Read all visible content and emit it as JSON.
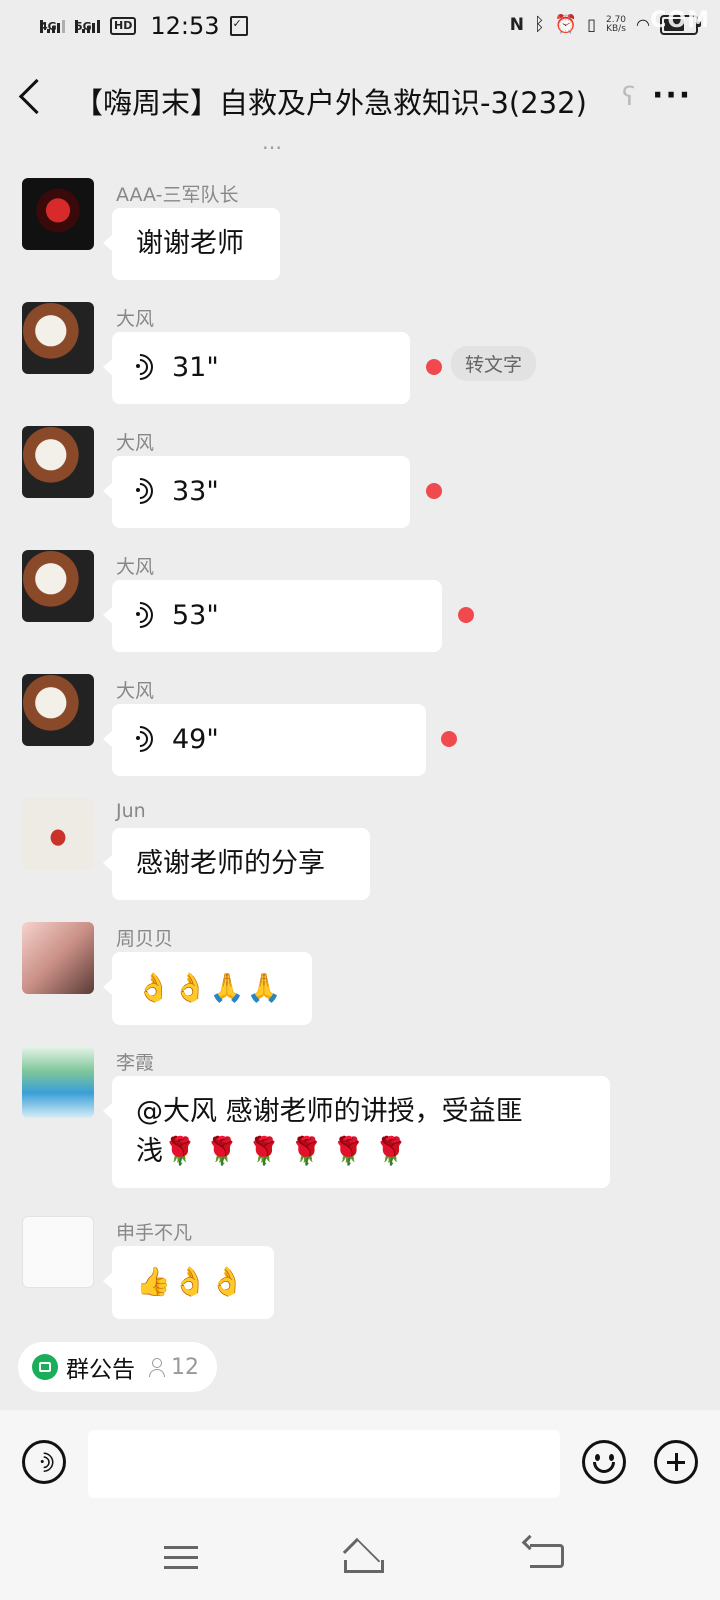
{
  "status_bar": {
    "net1": "4G",
    "net2": "5G",
    "hd": "HD",
    "time": "12:53",
    "speed_value": "2.70",
    "speed_unit": "KB/s",
    "watermark": "COM"
  },
  "header": {
    "title": "【嗨周末】自救及户外急救知识-3(232)",
    "more": "···"
  },
  "chat": {
    "cut_text": "…",
    "messages": [
      {
        "sender": "AAA-三军队长",
        "text": "谢谢老师"
      },
      {
        "sender": "大风",
        "duration": "31\"",
        "convert": "转文字"
      },
      {
        "sender": "大风",
        "duration": "33\""
      },
      {
        "sender": "大风",
        "duration": "53\""
      },
      {
        "sender": "大风",
        "duration": "49\""
      },
      {
        "sender": "Jun",
        "text": "感谢老师的分享"
      },
      {
        "sender": "周贝贝",
        "text": "👌👌🙏🙏"
      },
      {
        "sender": "李霞",
        "line1": "@大风  感谢老师的讲授，受益匪",
        "line2": "浅🌹 🌹 🌹 🌹 🌹 🌹"
      },
      {
        "sender": "申手不凡",
        "text": "👍👌👌"
      }
    ]
  },
  "announcement": {
    "label": "群公告",
    "count": "12"
  },
  "colors": {
    "background": "#ededed",
    "bubble": "#ffffff",
    "unread_dot": "#f04a4e",
    "announce_icon": "#1aad5a"
  }
}
